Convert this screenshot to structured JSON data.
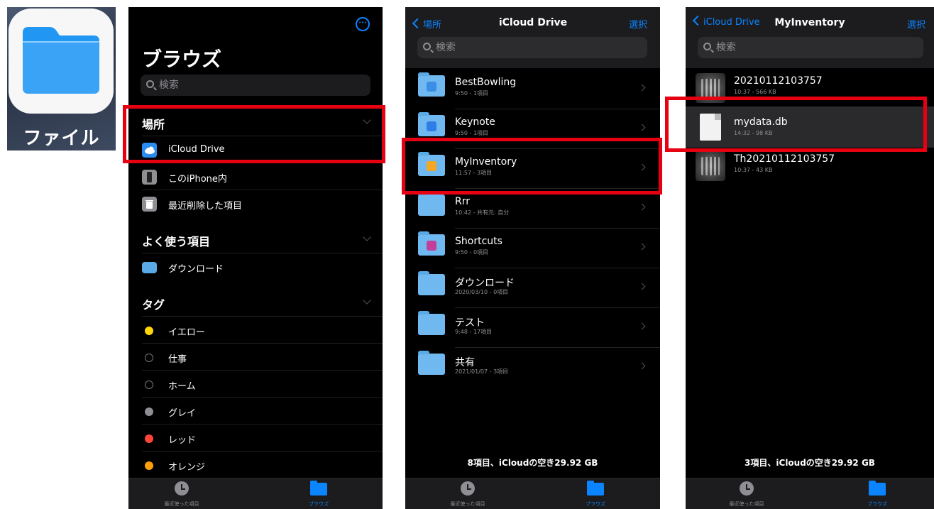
{
  "app_icon": {
    "label": "ファイル",
    "icon": "folder-icon"
  },
  "browse": {
    "more_icon": "ellipsis-circle-icon",
    "title": "ブラウズ",
    "search_placeholder": "検索",
    "locations_header": "場所",
    "locations": [
      {
        "label": "iCloud Drive",
        "icon": "icloud-icon"
      },
      {
        "label": "このiPhone内",
        "icon": "iphone-icon"
      },
      {
        "label": "最近削除した項目",
        "icon": "trash-icon"
      }
    ],
    "favorites_header": "よく使う項目",
    "favorites": [
      {
        "label": "ダウンロード",
        "icon": "download-folder-icon"
      }
    ],
    "tags_header": "タグ",
    "tags": [
      {
        "label": "イエロー",
        "color": "#ffd60a"
      },
      {
        "label": "仕事",
        "color": ""
      },
      {
        "label": "ホーム",
        "color": ""
      },
      {
        "label": "グレイ",
        "color": "#8e8e93"
      },
      {
        "label": "レッド",
        "color": "#ff453a"
      },
      {
        "label": "オレンジ",
        "color": "#ff9f0a"
      }
    ]
  },
  "tabbar": {
    "recents": "最近使った項目",
    "browse": "ブラウズ"
  },
  "icloud": {
    "back": "場所",
    "title": "iCloud Drive",
    "select": "選択",
    "search_placeholder": "検索",
    "folders": [
      {
        "name": "BestBowling",
        "meta": "9:50 - 1項目",
        "badge": "#3a8ee6"
      },
      {
        "name": "Keynote",
        "meta": "9:50 - 1項目",
        "badge": "#2f7ee8"
      },
      {
        "name": "MyInventory",
        "meta": "11:57 - 3項目",
        "badge": "#f5a623"
      },
      {
        "name": "Rrr",
        "meta": "10:42 - 共有元: 自分",
        "badge": ""
      },
      {
        "name": "Shortcuts",
        "meta": "9:50 - 0項目",
        "badge": "#c2409a"
      },
      {
        "name": "ダウンロード",
        "meta": "2020/03/10 - 0項目",
        "badge": ""
      },
      {
        "name": "テスト",
        "meta": "9:48 - 17項目",
        "badge": ""
      },
      {
        "name": "共有",
        "meta": "2021/01/07 - 3項目",
        "badge": ""
      }
    ],
    "footer": "8項目、iCloudの空き29.92 GB"
  },
  "myinventory": {
    "back": "iCloud Drive",
    "title": "MyInventory",
    "select": "選択",
    "search_placeholder": "検索",
    "files": [
      {
        "name": "20210112103757",
        "meta": "10:37 - 566 KB",
        "kind": "image"
      },
      {
        "name": "mydata.db",
        "meta": "14:32 - 98 KB",
        "kind": "doc"
      },
      {
        "name": "Th20210112103757",
        "meta": "10:37 - 43 KB",
        "kind": "image"
      }
    ],
    "footer": "3項目、iCloudの空き29.92 GB"
  },
  "colors": {
    "accent": "#0a84ff",
    "highlight": "#e60012"
  }
}
